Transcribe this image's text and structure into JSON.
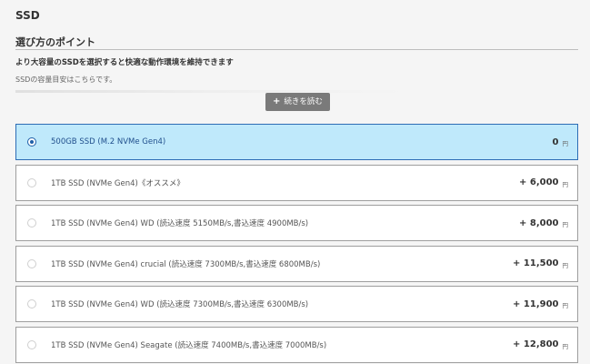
{
  "section": {
    "title": "SSD"
  },
  "tips": {
    "heading": "選び方のポイント",
    "lead": "より大容量のSSDを選択すると快適な動作環境を維持できます",
    "note": "SSDの容量目安はこちらです。",
    "read_more_label": "続きを読む"
  },
  "options": [
    {
      "label": "500GB SSD (M.2 NVMe Gen4)",
      "price": "0",
      "unit": "円",
      "selected": true
    },
    {
      "label": "1TB SSD (NVMe Gen4)《オススメ》",
      "price": "+ 6,000",
      "unit": "円",
      "selected": false
    },
    {
      "label": "1TB SSD (NVMe Gen4) WD (読込速度 5150MB/s,書込速度 4900MB/s)",
      "price": "+ 8,000",
      "unit": "円",
      "selected": false
    },
    {
      "label": "1TB SSD (NVMe Gen4) crucial (読込速度 7300MB/s,書込速度 6800MB/s)",
      "price": "+ 11,500",
      "unit": "円",
      "selected": false
    },
    {
      "label": "1TB SSD (NVMe Gen4) WD (読込速度 7300MB/s,書込速度 6300MB/s)",
      "price": "+ 11,900",
      "unit": "円",
      "selected": false
    },
    {
      "label": "1TB SSD (NVMe Gen4) Seagate (読込速度 7400MB/s,書込速度 7000MB/s)",
      "price": "+ 12,800",
      "unit": "円",
      "selected": false
    }
  ],
  "colors": {
    "selected_bg": "#bfe9fb",
    "selected_border": "#2d6cb5",
    "button_bg": "#7a7a7a"
  }
}
